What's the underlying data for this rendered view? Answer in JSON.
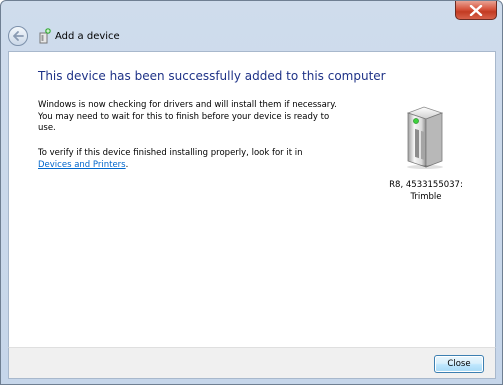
{
  "window": {
    "title": "Add a device",
    "close_icon": "close-icon"
  },
  "content": {
    "heading": "This device has been successfully added to this computer",
    "para1": "Windows is now checking for drivers and will install them if necessary. You may need to wait for this to finish before your device is ready to use.",
    "para2_prefix": "To verify if this device finished installing properly, look for it in",
    "link_text": "Devices and Printers",
    "para2_suffix": ".",
    "device_name_line1": "R8, 4533155037:",
    "device_name_line2": "Trimble"
  },
  "footer": {
    "close_label": "Close"
  },
  "colors": {
    "heading": "#1e3287",
    "link": "#0066cc",
    "status_led": "#3dd13d"
  }
}
